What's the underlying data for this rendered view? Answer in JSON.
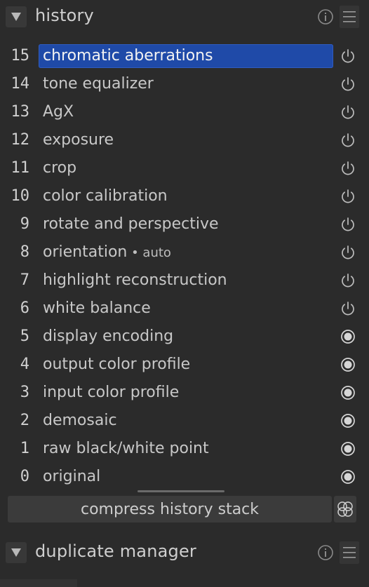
{
  "history_section": {
    "title": "history",
    "items": [
      {
        "num": "15",
        "label": "chromatic aberrations",
        "sub": "",
        "state": "power",
        "selected": true
      },
      {
        "num": "14",
        "label": "tone equalizer",
        "sub": "",
        "state": "power",
        "selected": false
      },
      {
        "num": "13",
        "label": "AgX",
        "sub": "",
        "state": "power",
        "selected": false
      },
      {
        "num": "12",
        "label": "exposure",
        "sub": "",
        "state": "power",
        "selected": false
      },
      {
        "num": "11",
        "label": "crop",
        "sub": "",
        "state": "power",
        "selected": false
      },
      {
        "num": "10",
        "label": "color calibration",
        "sub": "",
        "state": "power",
        "selected": false
      },
      {
        "num": "9",
        "label": "rotate and perspective",
        "sub": "",
        "state": "power",
        "selected": false
      },
      {
        "num": "8",
        "label": "orientation",
        "sub": " • auto",
        "state": "power",
        "selected": false
      },
      {
        "num": "7",
        "label": "highlight reconstruction",
        "sub": "",
        "state": "power",
        "selected": false
      },
      {
        "num": "6",
        "label": "white balance",
        "sub": "",
        "state": "power",
        "selected": false
      },
      {
        "num": "5",
        "label": "display encoding",
        "sub": "",
        "state": "always-on",
        "selected": false
      },
      {
        "num": "4",
        "label": "output color profile",
        "sub": "",
        "state": "always-on",
        "selected": false
      },
      {
        "num": "3",
        "label": "input color profile",
        "sub": "",
        "state": "always-on",
        "selected": false
      },
      {
        "num": "2",
        "label": "demosaic",
        "sub": "",
        "state": "always-on",
        "selected": false
      },
      {
        "num": "1",
        "label": "raw black/white point",
        "sub": "",
        "state": "always-on",
        "selected": false
      },
      {
        "num": "0",
        "label": "original",
        "sub": "",
        "state": "always-on",
        "selected": false
      }
    ],
    "compress_label": "compress history stack"
  },
  "duplicate_section": {
    "title": "duplicate manager"
  },
  "icons": {
    "expand": "triangle-down-icon",
    "info": "info-icon",
    "presets": "hamburger-menu-icon",
    "power": "power-icon",
    "always_on": "always-on-icon",
    "styles": "styles-icon"
  },
  "colors": {
    "background": "#2b2b2b",
    "selection": "#1f4aa8",
    "text": "#c8c8c8"
  }
}
